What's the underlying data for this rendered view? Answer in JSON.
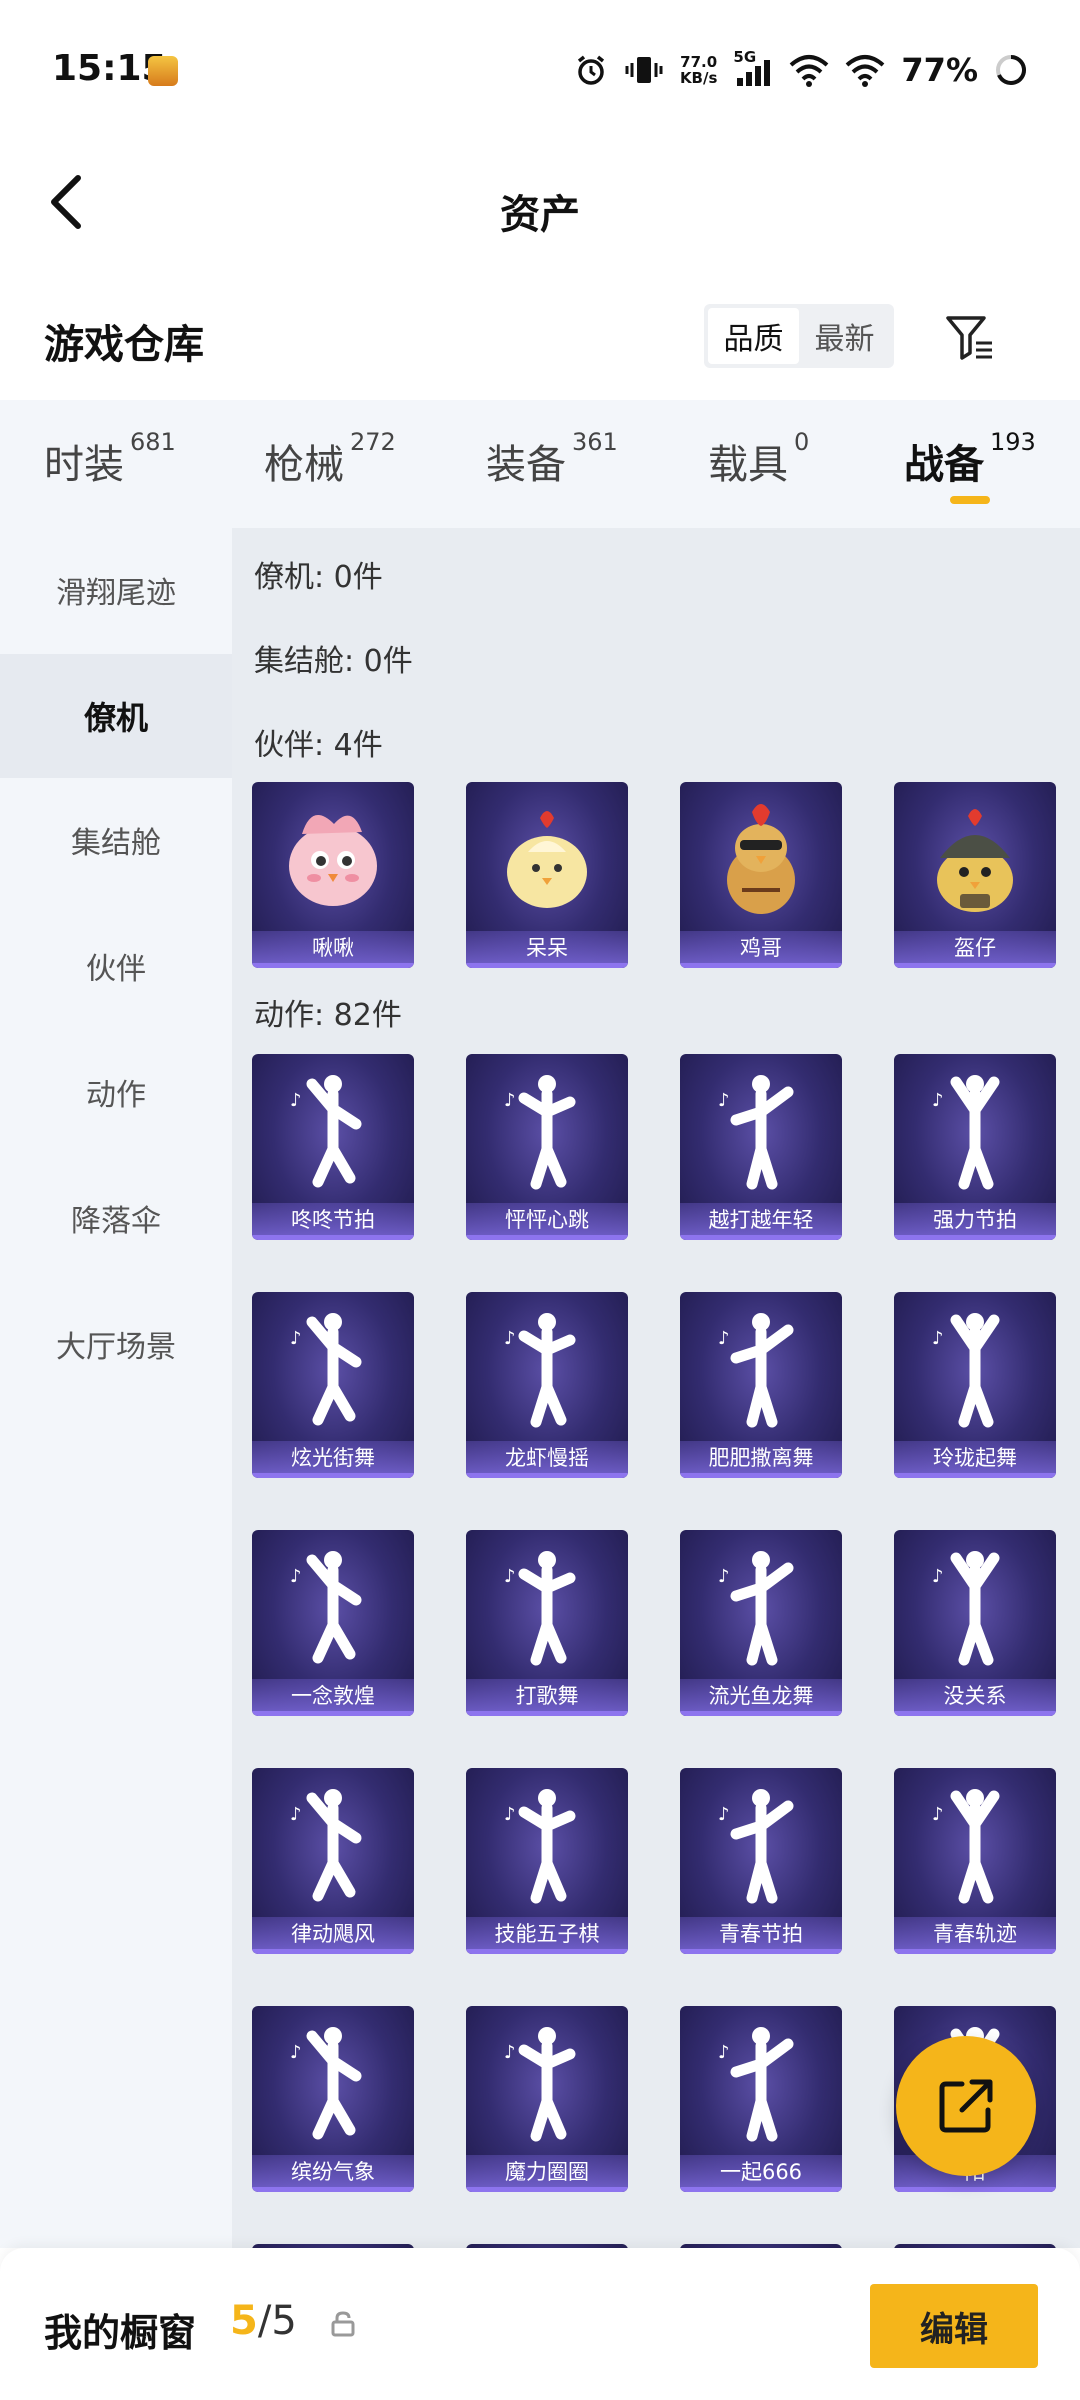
{
  "status_bar": {
    "time": "15:15",
    "net_speed_value": "77.0",
    "net_speed_unit": "KB/s",
    "network": "5G",
    "battery": "77%"
  },
  "header": {
    "title": "资产"
  },
  "warehouse": {
    "title": "游戏仓库",
    "sort_options": [
      {
        "label": "品质",
        "selected": true
      },
      {
        "label": "最新",
        "selected": false
      }
    ]
  },
  "tabs": [
    {
      "label": "时装",
      "count": "681",
      "active": false
    },
    {
      "label": "枪械",
      "count": "272",
      "active": false
    },
    {
      "label": "装备",
      "count": "361",
      "active": false
    },
    {
      "label": "载具",
      "count": "0",
      "active": false
    },
    {
      "label": "战备",
      "count": "193",
      "active": true
    }
  ],
  "sidebar": {
    "items": [
      {
        "label": "滑翔尾迹",
        "active": false
      },
      {
        "label": "僚机",
        "active": true
      },
      {
        "label": "集结舱",
        "active": false
      },
      {
        "label": "伙伴",
        "active": false
      },
      {
        "label": "动作",
        "active": false
      },
      {
        "label": "降落伞",
        "active": false
      },
      {
        "label": "大厅场景",
        "active": false
      }
    ]
  },
  "sections": {
    "wingman": {
      "label": "僚机: 0件"
    },
    "rally_pod": {
      "label": "集结舱: 0件"
    },
    "partners": {
      "label": "伙伴: 4件",
      "items": [
        "啾啾",
        "呆呆",
        "鸡哥",
        "盔仔"
      ]
    },
    "emotes": {
      "label": "动作: 82件",
      "items": [
        "咚咚节拍",
        "怦怦心跳",
        "越打越年轻",
        "强力节拍",
        "炫光街舞",
        "龙虾慢摇",
        "肥肥撒离舞",
        "玲珑起舞",
        "一念敦煌",
        "打歌舞",
        "流光鱼龙舞",
        "没关系",
        "律动飓风",
        "技能五子棋",
        "青春节拍",
        "青春轨迹",
        "缤纷气象",
        "魔力圈圈",
        "一起666",
        "阳"
      ]
    }
  },
  "bottom_bar": {
    "label": "我的橱窗",
    "count_current": "5",
    "count_separator": "/",
    "count_total": "5",
    "edit_label": "编辑"
  },
  "colors": {
    "accent": "#f5b51a",
    "card_bg": "#332c70",
    "card_stripe": "#8d74ee",
    "sidebar_bg": "#f3f6fa",
    "content_bg": "#e8ecf1"
  }
}
